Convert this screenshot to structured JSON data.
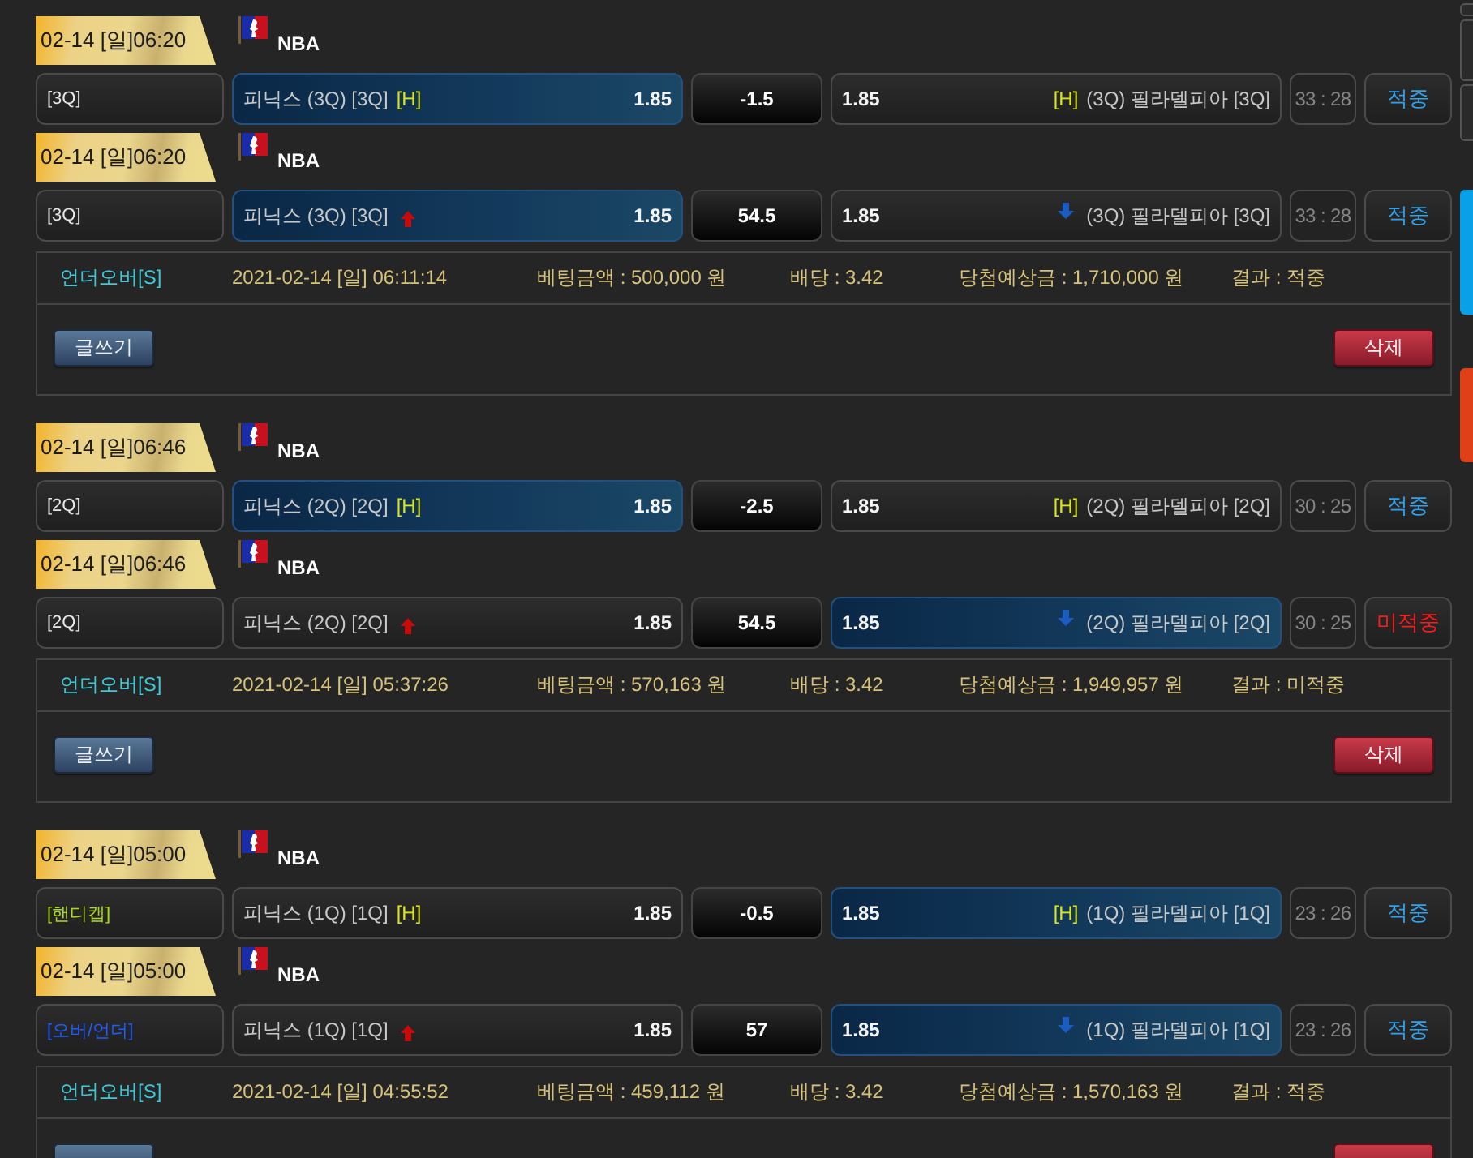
{
  "bets": [
    {
      "matches": [
        {
          "date": "02-14 [일]06:20",
          "league": "NBA",
          "kind": "handicap",
          "market": {
            "label": "[3Q]",
            "color": "#e8e8e8"
          },
          "home": {
            "name": "피닉스 (3Q) [3Q]",
            "mark": "[H]",
            "odds": "1.85",
            "selected": true
          },
          "line": "-1.5",
          "away": {
            "odds": "1.85",
            "mark": "[H]",
            "name": "(3Q) 필라델피아 [3Q]",
            "selected": false
          },
          "score": "33 : 28",
          "result": {
            "label": "적중",
            "won": true
          }
        },
        {
          "date": "02-14 [일]06:20",
          "league": "NBA",
          "kind": "over_under",
          "market": {
            "label": "[3Q]",
            "color": "#e8e8e8"
          },
          "home": {
            "name": "피닉스 (3Q) [3Q]",
            "odds": "1.85",
            "selected": true
          },
          "line": "54.5",
          "away": {
            "odds": "1.85",
            "name": "(3Q) 필라델피아 [3Q]",
            "selected": false
          },
          "score": "33 : 28",
          "result": {
            "label": "적중",
            "won": true
          }
        }
      ],
      "summary": {
        "bet_type": "언더오버[S]",
        "placed_at": "2021-02-14 [일] 06:11:14",
        "amount": "베팅금액 : 500,000 원",
        "odds": "배당 : 3.42",
        "payout": "당첨예상금 : 1,710,000 원",
        "result": "결과 : 적중"
      },
      "buttons": {
        "write": "글쓰기",
        "delete": "삭제"
      }
    },
    {
      "matches": [
        {
          "date": "02-14 [일]06:46",
          "league": "NBA",
          "kind": "handicap",
          "market": {
            "label": "[2Q]",
            "color": "#e8e8e8"
          },
          "home": {
            "name": "피닉스 (2Q) [2Q]",
            "mark": "[H]",
            "odds": "1.85",
            "selected": true
          },
          "line": "-2.5",
          "away": {
            "odds": "1.85",
            "mark": "[H]",
            "name": "(2Q) 필라델피아 [2Q]",
            "selected": false
          },
          "score": "30 : 25",
          "result": {
            "label": "적중",
            "won": true
          }
        },
        {
          "date": "02-14 [일]06:46",
          "league": "NBA",
          "kind": "over_under",
          "market": {
            "label": "[2Q]",
            "color": "#e8e8e8"
          },
          "home": {
            "name": "피닉스 (2Q) [2Q]",
            "odds": "1.85",
            "selected": false
          },
          "line": "54.5",
          "away": {
            "odds": "1.85",
            "name": "(2Q) 필라델피아 [2Q]",
            "selected": true
          },
          "score": "30 : 25",
          "result": {
            "label": "미적중",
            "won": false
          }
        }
      ],
      "summary": {
        "bet_type": "언더오버[S]",
        "placed_at": "2021-02-14 [일] 05:37:26",
        "amount": "베팅금액 : 570,163 원",
        "odds": "배당 : 3.42",
        "payout": "당첨예상금 : 1,949,957 원",
        "result": "결과 : 미적중"
      },
      "buttons": {
        "write": "글쓰기",
        "delete": "삭제"
      }
    },
    {
      "matches": [
        {
          "date": "02-14 [일]05:00",
          "league": "NBA",
          "kind": "handicap",
          "market": {
            "label": "[핸디캡]",
            "color": "#a8d818"
          },
          "home": {
            "name": "피닉스 (1Q) [1Q]",
            "mark": "[H]",
            "odds": "1.85",
            "selected": false
          },
          "line": "-0.5",
          "away": {
            "odds": "1.85",
            "mark": "[H]",
            "name": "(1Q) 필라델피아 [1Q]",
            "selected": true
          },
          "score": "23 : 26",
          "result": {
            "label": "적중",
            "won": true
          }
        },
        {
          "date": "02-14 [일]05:00",
          "league": "NBA",
          "kind": "over_under",
          "market": {
            "label": "[오버/언더]",
            "color": "#1e5cff"
          },
          "home": {
            "name": "피닉스 (1Q) [1Q]",
            "odds": "1.85",
            "selected": false
          },
          "line": "57",
          "away": {
            "odds": "1.85",
            "name": "(1Q) 필라델피아 [1Q]",
            "selected": true
          },
          "score": "23 : 26",
          "result": {
            "label": "적중",
            "won": true
          }
        }
      ],
      "summary": {
        "bet_type": "언더오버[S]",
        "placed_at": "2021-02-14 [일] 04:55:52",
        "amount": "베팅금액 : 459,112 원",
        "odds": "배당 : 3.42",
        "payout": "당첨예상금 : 1,570,163 원",
        "result": "결과 : 적중"
      }
    }
  ],
  "side_tabs": [
    {
      "color": "#2a2a2a"
    },
    {
      "color": "#2a2a2a"
    },
    {
      "color": "#2a2a2a"
    },
    {
      "color": "#0aa0e8"
    },
    {
      "color": "#e04018"
    }
  ]
}
